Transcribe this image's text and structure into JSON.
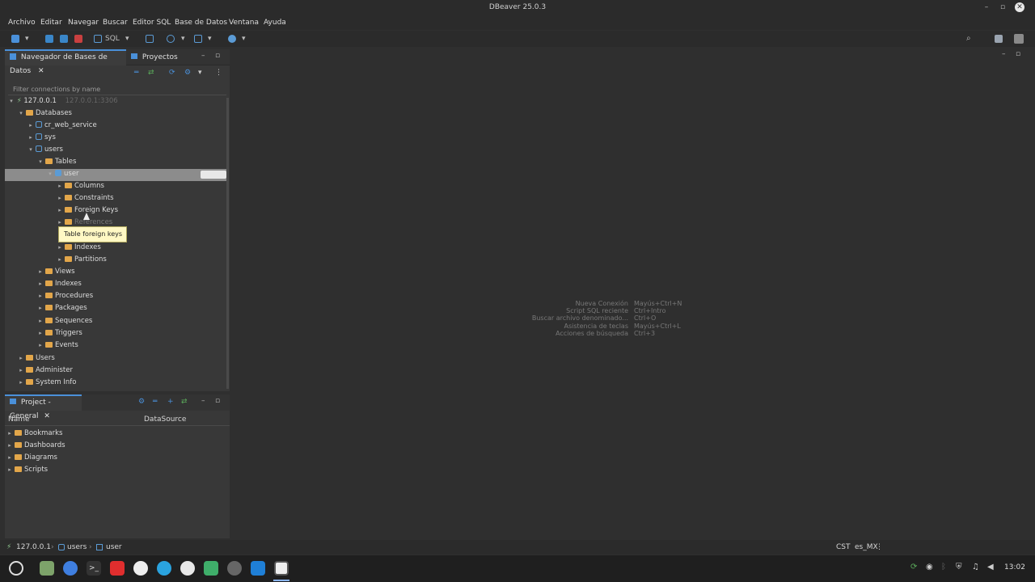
{
  "window": {
    "title": "DBeaver 25.0.3"
  },
  "menu": [
    "Archivo",
    "Editar",
    "Navegar",
    "Buscar",
    "Editor SQL",
    "Base de Datos",
    "Ventana",
    "Ayuda"
  ],
  "toolbar": {
    "sql_label": "SQL"
  },
  "navigator": {
    "tab_label": "Navegador de Bases de Datos",
    "projects_tab_label": "Proyectos",
    "filter_placeholder": "Filter connections by name",
    "connection": {
      "name": "127.0.0.1",
      "detail": "127.0.0.1:3306"
    },
    "tree": {
      "databases": "Databases",
      "db_cr": "cr_web_service",
      "db_sys": "sys",
      "db_users": "users",
      "tables": "Tables",
      "table_user": "user",
      "columns": "Columns",
      "constraints": "Constraints",
      "foreign_keys": "Foreign Keys",
      "references": "References",
      "indexes_t": "Indexes",
      "partitions": "Partitions",
      "views": "Views",
      "indexes": "Indexes",
      "procedures": "Procedures",
      "packages": "Packages",
      "sequences": "Sequences",
      "triggers": "Triggers",
      "events": "Events",
      "users": "Users",
      "administer": "Administer",
      "system_info": "System Info"
    },
    "tooltip": "Table foreign keys"
  },
  "project": {
    "tab_label": "Project - General",
    "col_name": "Name",
    "col_datasource": "DataSource",
    "items": [
      "Bookmarks",
      "Dashboards",
      "Diagrams",
      "Scripts"
    ]
  },
  "editor_hints": [
    {
      "action": "Nueva Conexión",
      "shortcut": "Mayús+Ctrl+N"
    },
    {
      "action": "Script SQL reciente",
      "shortcut": "Ctrl+Intro"
    },
    {
      "action": "Buscar archivo denominado...",
      "shortcut": "Ctrl+O"
    },
    {
      "action": "Asistencia de teclas",
      "shortcut": "Mayús+Ctrl+L"
    },
    {
      "action": "Acciones de búsqueda",
      "shortcut": "Ctrl+3"
    }
  ],
  "statusbar": {
    "crumb_conn": "127.0.0.1",
    "crumb_db": "users",
    "crumb_table": "user",
    "tz": "CST",
    "locale": "es_MX"
  },
  "taskbar": {
    "clock": "13:02"
  },
  "colors": {
    "accent": "#4a90d9",
    "folder": "#e2a64a",
    "selection": "#8c8c8c",
    "tooltip_bg": "#fff8c4"
  }
}
